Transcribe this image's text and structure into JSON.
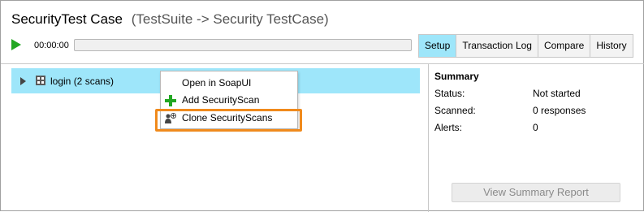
{
  "window": {
    "title": "SecurityTest Case",
    "subtitle": "(TestSuite -> Security TestCase)"
  },
  "toolbar": {
    "play_icon": "play-icon",
    "play_color": "#22a722",
    "elapsed_time": "00:00:00",
    "progress": 0
  },
  "tabs": [
    {
      "label": "Setup",
      "active": true
    },
    {
      "label": "Transaction Log",
      "active": false
    },
    {
      "label": "Compare",
      "active": false
    },
    {
      "label": "History",
      "active": false
    }
  ],
  "tree": {
    "items": [
      {
        "label": "login (2 scans)",
        "icon": "test-step-icon",
        "expand_icon": "expand-arrow-icon",
        "selected": true
      }
    ]
  },
  "context_menu": {
    "items": [
      {
        "label": "Open in SoapUI",
        "icon": ""
      },
      {
        "label": "Add SecurityScan",
        "icon": "plus-icon"
      },
      {
        "label": "Clone SecurityScans",
        "icon": "clone-icon",
        "highlighted": true
      }
    ],
    "highlight_color": "#f08a1c"
  },
  "summary": {
    "title": "Summary",
    "rows": [
      {
        "key": "Status:",
        "value": "Not started"
      },
      {
        "key": "Scanned:",
        "value": "0 responses"
      },
      {
        "key": "Alerts:",
        "value": "0"
      }
    ],
    "report_button": "View Summary Report"
  },
  "colors": {
    "selection": "#9ee6fa",
    "accent_green": "#22a722",
    "highlight_orange": "#f08a1c"
  }
}
